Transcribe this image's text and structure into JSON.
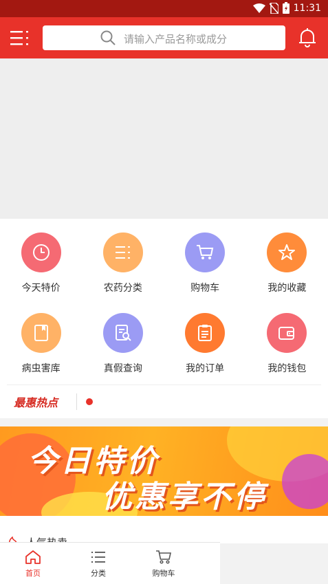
{
  "status_bar": {
    "time": "11:31"
  },
  "header": {
    "search_placeholder": "请输入产品名称或成分"
  },
  "grid": [
    {
      "label": "今天特价",
      "icon": "clock-icon",
      "color": "#f56a73"
    },
    {
      "label": "农药分类",
      "icon": "list-icon",
      "color": "#ffb266"
    },
    {
      "label": "购物车",
      "icon": "cart-icon",
      "color": "#9b9bf4"
    },
    {
      "label": "我的收藏",
      "icon": "star-icon",
      "color": "#ff8c3a"
    },
    {
      "label": "病虫害库",
      "icon": "database-icon",
      "color": "#ffb266"
    },
    {
      "label": "真假查询",
      "icon": "query-icon",
      "color": "#9b9bf4"
    },
    {
      "label": "我的订单",
      "icon": "clipboard-icon",
      "color": "#ff7a30"
    },
    {
      "label": "我的钱包",
      "icon": "wallet-icon",
      "color": "#f56a73"
    }
  ],
  "hot": {
    "title": "最惠热点"
  },
  "promo": {
    "line1": "今日特价",
    "line2": "优惠享不停"
  },
  "popular": {
    "title": "人气热卖"
  },
  "bottom_nav": [
    {
      "label": "首页",
      "icon": "home-icon",
      "active": true
    },
    {
      "label": "分类",
      "icon": "list-icon",
      "active": false
    },
    {
      "label": "购物车",
      "icon": "cart-icon",
      "active": false
    }
  ],
  "colors": {
    "primary": "#e8322a",
    "status_bar": "#a31811"
  }
}
